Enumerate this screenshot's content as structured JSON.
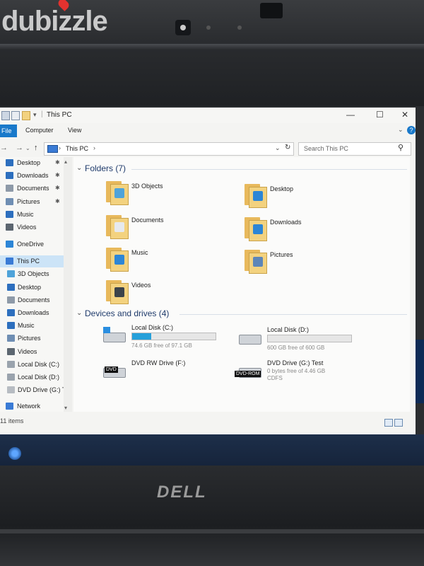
{
  "watermark": "dubizzle",
  "laptop_brand": "DELL",
  "window": {
    "title": "This PC",
    "controls": {
      "minimize": "—",
      "maximize": "☐",
      "close": "✕"
    }
  },
  "ribbon": {
    "tabs": [
      "File",
      "Computer",
      "View"
    ]
  },
  "address": {
    "path": "This PC",
    "separator": "›",
    "search_placeholder": "Search This PC"
  },
  "nav_pane": {
    "quick_access": [
      {
        "label": "Desktop",
        "pinned": true,
        "icon": "desktop-icon",
        "color": "#2d6fbe"
      },
      {
        "label": "Downloads",
        "pinned": true,
        "icon": "downloads-icon",
        "color": "#2d6fbe"
      },
      {
        "label": "Documents",
        "pinned": true,
        "icon": "documents-icon",
        "color": "#8e9aa8"
      },
      {
        "label": "Pictures",
        "pinned": true,
        "icon": "pictures-icon",
        "color": "#6f8eb3"
      },
      {
        "label": "Music",
        "pinned": false,
        "icon": "music-icon",
        "color": "#2d6fbe"
      },
      {
        "label": "Videos",
        "pinned": false,
        "icon": "videos-icon",
        "color": "#5c6670"
      }
    ],
    "onedrive": "OneDrive",
    "this_pc": "This PC",
    "this_pc_children": [
      {
        "label": "3D Objects",
        "icon": "3d-objects-icon",
        "color": "#4fa3d9"
      },
      {
        "label": "Desktop",
        "icon": "desktop-icon",
        "color": "#2d6fbe"
      },
      {
        "label": "Documents",
        "icon": "documents-icon",
        "color": "#8e9aa8"
      },
      {
        "label": "Downloads",
        "icon": "downloads-icon",
        "color": "#2d6fbe"
      },
      {
        "label": "Music",
        "icon": "music-icon",
        "color": "#2d6fbe"
      },
      {
        "label": "Pictures",
        "icon": "pictures-icon",
        "color": "#6f8eb3"
      },
      {
        "label": "Videos",
        "icon": "videos-icon",
        "color": "#5c6670"
      },
      {
        "label": "Local Disk (C:)",
        "icon": "drive-icon",
        "color": "#9aa3ad"
      },
      {
        "label": "Local Disk (D:)",
        "icon": "drive-icon",
        "color": "#9aa3ad"
      },
      {
        "label": "DVD Drive (G:) T",
        "icon": "dvd-drive-icon",
        "color": "#b7bcc2"
      }
    ],
    "network": "Network"
  },
  "content": {
    "folders_header": "Folders (7)",
    "folders": [
      {
        "label": "3D Objects",
        "emblem": "3d-objects-icon",
        "emblem_color": "#4fa3d9"
      },
      {
        "label": "Desktop",
        "emblem": "desktop-icon",
        "emblem_color": "#2d86d6"
      },
      {
        "label": "Documents",
        "emblem": "documents-icon",
        "emblem_color": "#e6e9ee"
      },
      {
        "label": "Downloads",
        "emblem": "downloads-icon",
        "emblem_color": "#2d86d6"
      },
      {
        "label": "Music",
        "emblem": "music-icon",
        "emblem_color": "#2d86d6"
      },
      {
        "label": "Pictures",
        "emblem": "pictures-icon",
        "emblem_color": "#5d86b8"
      },
      {
        "label": "Videos",
        "emblem": "videos-icon",
        "emblem_color": "#3c434a"
      }
    ],
    "drives_header": "Devices and drives (4)",
    "drives": [
      {
        "label": "Local Disk (C:)",
        "free_text": "74.6 GB free of 97.1 GB",
        "used_fraction": 0.23,
        "has_bar": true,
        "icon": "windows-drive-icon"
      },
      {
        "label": "Local Disk (D:)",
        "free_text": "600 GB free of 600 GB",
        "used_fraction": 0.0,
        "has_bar": true,
        "icon": "drive-icon"
      },
      {
        "label": "DVD RW Drive (F:)",
        "free_text": "",
        "has_bar": false,
        "icon": "dvd-drive-icon",
        "badge": "DVD"
      },
      {
        "label": "DVD Drive (G:) Test",
        "free_text": "0 bytes free of 4.46 GB",
        "fs_text": "CDFS",
        "has_bar": false,
        "icon": "dvd-rom-icon",
        "badge": "DVD-ROM"
      }
    ]
  },
  "status": {
    "items": "11 items"
  },
  "colors": {
    "accent": "#1979ca",
    "selection": "#cce4f7",
    "drive_fill": "#26a0da"
  }
}
